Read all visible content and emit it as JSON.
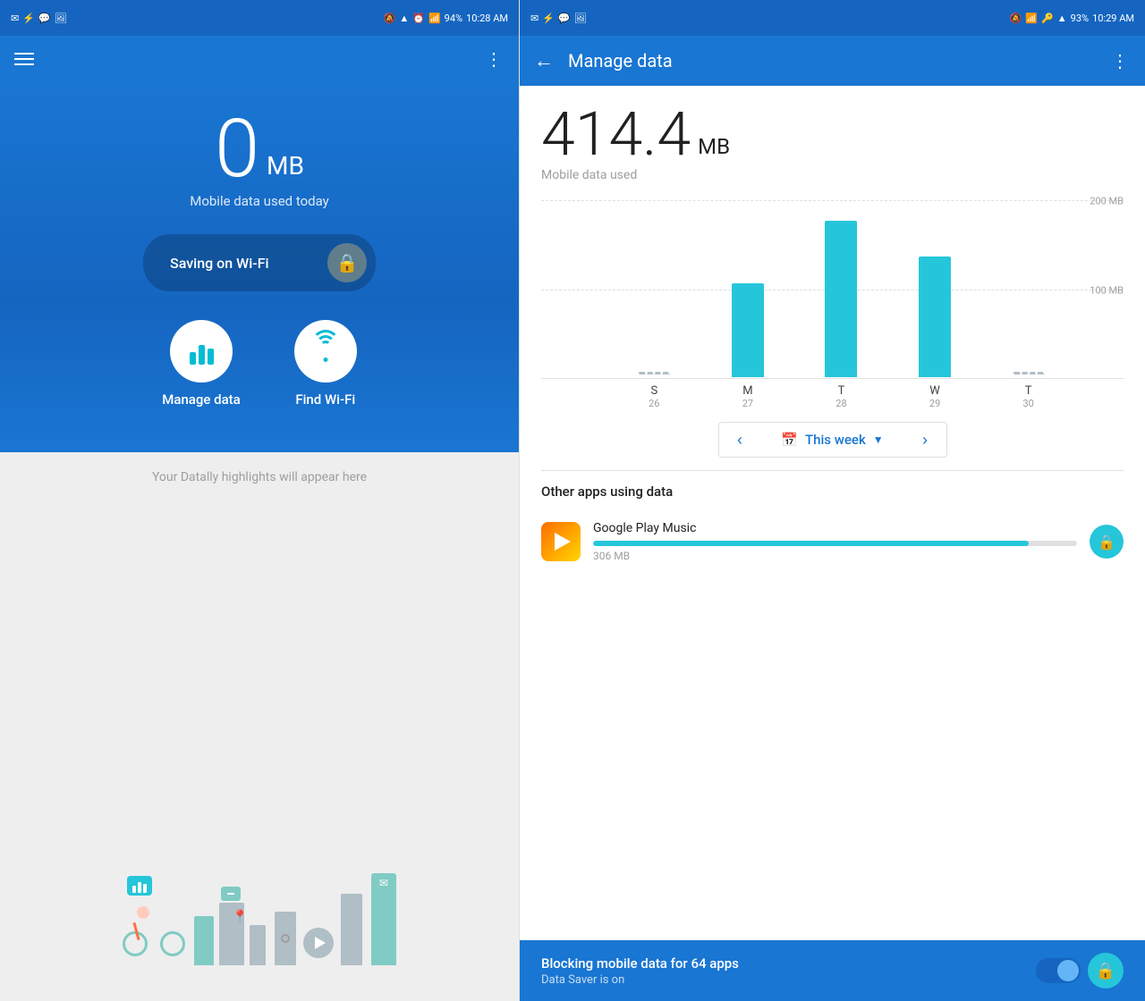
{
  "left": {
    "statusBar": {
      "time": "10:28 AM",
      "battery": "94%"
    },
    "dataUsed": {
      "amount": "0",
      "unit": "MB",
      "label": "Mobile data used today"
    },
    "wifiSaving": {
      "label": "Saving on Wi-Fi"
    },
    "actions": [
      {
        "id": "manage-data",
        "label": "Manage data"
      },
      {
        "id": "find-wifi",
        "label": "Find Wi-Fi"
      }
    ],
    "highlights": {
      "text": "Your Datally highlights will appear here"
    }
  },
  "right": {
    "statusBar": {
      "time": "10:29 AM",
      "battery": "93%"
    },
    "header": {
      "title": "Manage data"
    },
    "dataUsed": {
      "amount": "414.4",
      "unit": "MB",
      "label": "Mobile data used"
    },
    "chart": {
      "gridLines": [
        {
          "label": "200 MB",
          "pct": 100
        },
        {
          "label": "100 MB",
          "pct": 50
        }
      ],
      "bars": [
        {
          "day": "S",
          "date": "26",
          "heightPct": 4,
          "type": "dashed"
        },
        {
          "day": "M",
          "date": "27",
          "heightPct": 58,
          "type": "bar"
        },
        {
          "day": "T",
          "date": "28",
          "heightPct": 100,
          "type": "bar"
        },
        {
          "day": "W",
          "date": "29",
          "heightPct": 75,
          "type": "bar"
        },
        {
          "day": "T",
          "date": "30",
          "heightPct": 4,
          "type": "dashed"
        }
      ]
    },
    "weekSelector": {
      "label": "This week",
      "prevLabel": "‹",
      "nextLabel": "›"
    },
    "appsSection": {
      "title": "Other apps using data",
      "apps": [
        {
          "name": "Google Play Music",
          "mb": "306 MB",
          "progressPct": 90
        }
      ]
    },
    "blockingBar": {
      "title": "Blocking mobile data for 64 apps",
      "subtitle": "Data Saver is on"
    }
  }
}
